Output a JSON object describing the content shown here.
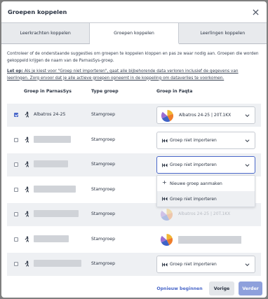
{
  "modal": {
    "title": "Groepen koppelen"
  },
  "tabs": [
    {
      "label": "Leerkrachten koppelen",
      "active": false
    },
    {
      "label": "Groepen koppelen",
      "active": true
    },
    {
      "label": "Leerlingen koppelen",
      "active": false
    }
  ],
  "intro": "Controleer of de onderstaande suggesties om groepen te koppelen kloppen en pas ze waar nodig aan. Groepen die worden gekoppeld krijgen de naam van de ParnasSys-groep.",
  "warning": {
    "prefix": "Let op:",
    "text": " Als je kiest voor \"Groep niet importeren\", gaat alle bijbehorende data verloren inclusief de gegevens van leerlingen. Zorg ervoor dat je alle actieve groepen opneemt in de koppeling om dataverlies te voorkomen."
  },
  "table": {
    "headers": {
      "group": "Groep in ParnasSys",
      "type": "Type groep",
      "target": "Groep in Faqta"
    },
    "rows": [
      {
        "checked": true,
        "name": "Albatros 24-25",
        "type": "Stamgroep",
        "selection": "Albatros 24-25 | 20T.1KX",
        "selection_kind": "logo"
      },
      {
        "checked": false,
        "name": "",
        "type": "Stamgroep",
        "selection": "Groep niet importeren",
        "selection_kind": "skip"
      },
      {
        "checked": false,
        "name": "",
        "type": "Stamgroep",
        "selection": "Groep niet importeren",
        "selection_kind": "skip",
        "open": true
      },
      {
        "checked": false,
        "name": "",
        "type": "Stamgroep"
      },
      {
        "checked": false,
        "name": "",
        "type": "Stamgroep"
      },
      {
        "checked": false,
        "name": "",
        "type": "Stamgroep"
      },
      {
        "checked": false,
        "name": "",
        "type": "Stamgroep",
        "selection": "Groep niet importeren",
        "selection_kind": "skip"
      }
    ]
  },
  "dropdown": {
    "options": [
      {
        "label": "Nieuwe groep aanmaken",
        "icon": "plus-icon"
      },
      {
        "label": "Groep niet importeren",
        "icon": "skip-icon",
        "highlighted": true
      },
      {
        "label": "Albatros 24-25 | 20T.1KX",
        "icon": "pie-logo-icon",
        "dimmed": true
      },
      {
        "label": "",
        "icon": "pie-logo-icon",
        "dimmed": false
      }
    ]
  },
  "footer": {
    "reset_label": "Opnieuw beginnen",
    "prev_label": "Vorige",
    "next_label": "Verder"
  },
  "colors": {
    "accent": "#4a68c9",
    "next_disabled": "#8ea0dc",
    "row_alt": "#eef0f3"
  }
}
